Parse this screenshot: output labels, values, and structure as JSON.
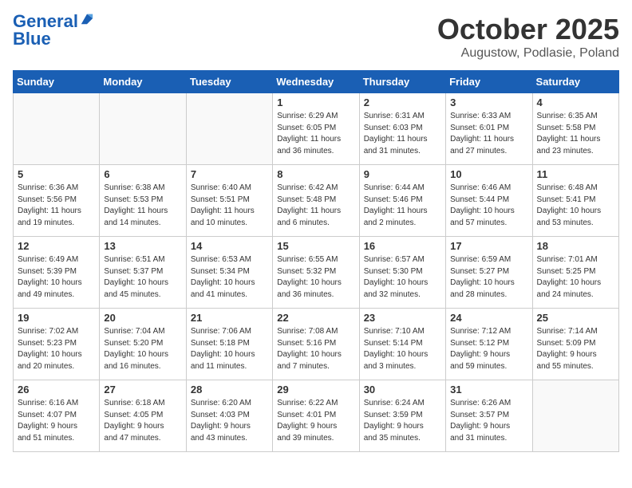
{
  "logo": {
    "line1": "General",
    "line2": "Blue"
  },
  "title": "October 2025",
  "subtitle": "Augustow, Podlasie, Poland",
  "days_of_week": [
    "Sunday",
    "Monday",
    "Tuesday",
    "Wednesday",
    "Thursday",
    "Friday",
    "Saturday"
  ],
  "weeks": [
    [
      {
        "day": "",
        "info": ""
      },
      {
        "day": "",
        "info": ""
      },
      {
        "day": "",
        "info": ""
      },
      {
        "day": "1",
        "info": "Sunrise: 6:29 AM\nSunset: 6:05 PM\nDaylight: 11 hours\nand 36 minutes."
      },
      {
        "day": "2",
        "info": "Sunrise: 6:31 AM\nSunset: 6:03 PM\nDaylight: 11 hours\nand 31 minutes."
      },
      {
        "day": "3",
        "info": "Sunrise: 6:33 AM\nSunset: 6:01 PM\nDaylight: 11 hours\nand 27 minutes."
      },
      {
        "day": "4",
        "info": "Sunrise: 6:35 AM\nSunset: 5:58 PM\nDaylight: 11 hours\nand 23 minutes."
      }
    ],
    [
      {
        "day": "5",
        "info": "Sunrise: 6:36 AM\nSunset: 5:56 PM\nDaylight: 11 hours\nand 19 minutes."
      },
      {
        "day": "6",
        "info": "Sunrise: 6:38 AM\nSunset: 5:53 PM\nDaylight: 11 hours\nand 14 minutes."
      },
      {
        "day": "7",
        "info": "Sunrise: 6:40 AM\nSunset: 5:51 PM\nDaylight: 11 hours\nand 10 minutes."
      },
      {
        "day": "8",
        "info": "Sunrise: 6:42 AM\nSunset: 5:48 PM\nDaylight: 11 hours\nand 6 minutes."
      },
      {
        "day": "9",
        "info": "Sunrise: 6:44 AM\nSunset: 5:46 PM\nDaylight: 11 hours\nand 2 minutes."
      },
      {
        "day": "10",
        "info": "Sunrise: 6:46 AM\nSunset: 5:44 PM\nDaylight: 10 hours\nand 57 minutes."
      },
      {
        "day": "11",
        "info": "Sunrise: 6:48 AM\nSunset: 5:41 PM\nDaylight: 10 hours\nand 53 minutes."
      }
    ],
    [
      {
        "day": "12",
        "info": "Sunrise: 6:49 AM\nSunset: 5:39 PM\nDaylight: 10 hours\nand 49 minutes."
      },
      {
        "day": "13",
        "info": "Sunrise: 6:51 AM\nSunset: 5:37 PM\nDaylight: 10 hours\nand 45 minutes."
      },
      {
        "day": "14",
        "info": "Sunrise: 6:53 AM\nSunset: 5:34 PM\nDaylight: 10 hours\nand 41 minutes."
      },
      {
        "day": "15",
        "info": "Sunrise: 6:55 AM\nSunset: 5:32 PM\nDaylight: 10 hours\nand 36 minutes."
      },
      {
        "day": "16",
        "info": "Sunrise: 6:57 AM\nSunset: 5:30 PM\nDaylight: 10 hours\nand 32 minutes."
      },
      {
        "day": "17",
        "info": "Sunrise: 6:59 AM\nSunset: 5:27 PM\nDaylight: 10 hours\nand 28 minutes."
      },
      {
        "day": "18",
        "info": "Sunrise: 7:01 AM\nSunset: 5:25 PM\nDaylight: 10 hours\nand 24 minutes."
      }
    ],
    [
      {
        "day": "19",
        "info": "Sunrise: 7:02 AM\nSunset: 5:23 PM\nDaylight: 10 hours\nand 20 minutes."
      },
      {
        "day": "20",
        "info": "Sunrise: 7:04 AM\nSunset: 5:20 PM\nDaylight: 10 hours\nand 16 minutes."
      },
      {
        "day": "21",
        "info": "Sunrise: 7:06 AM\nSunset: 5:18 PM\nDaylight: 10 hours\nand 11 minutes."
      },
      {
        "day": "22",
        "info": "Sunrise: 7:08 AM\nSunset: 5:16 PM\nDaylight: 10 hours\nand 7 minutes."
      },
      {
        "day": "23",
        "info": "Sunrise: 7:10 AM\nSunset: 5:14 PM\nDaylight: 10 hours\nand 3 minutes."
      },
      {
        "day": "24",
        "info": "Sunrise: 7:12 AM\nSunset: 5:12 PM\nDaylight: 9 hours\nand 59 minutes."
      },
      {
        "day": "25",
        "info": "Sunrise: 7:14 AM\nSunset: 5:09 PM\nDaylight: 9 hours\nand 55 minutes."
      }
    ],
    [
      {
        "day": "26",
        "info": "Sunrise: 6:16 AM\nSunset: 4:07 PM\nDaylight: 9 hours\nand 51 minutes."
      },
      {
        "day": "27",
        "info": "Sunrise: 6:18 AM\nSunset: 4:05 PM\nDaylight: 9 hours\nand 47 minutes."
      },
      {
        "day": "28",
        "info": "Sunrise: 6:20 AM\nSunset: 4:03 PM\nDaylight: 9 hours\nand 43 minutes."
      },
      {
        "day": "29",
        "info": "Sunrise: 6:22 AM\nSunset: 4:01 PM\nDaylight: 9 hours\nand 39 minutes."
      },
      {
        "day": "30",
        "info": "Sunrise: 6:24 AM\nSunset: 3:59 PM\nDaylight: 9 hours\nand 35 minutes."
      },
      {
        "day": "31",
        "info": "Sunrise: 6:26 AM\nSunset: 3:57 PM\nDaylight: 9 hours\nand 31 minutes."
      },
      {
        "day": "",
        "info": ""
      }
    ]
  ]
}
